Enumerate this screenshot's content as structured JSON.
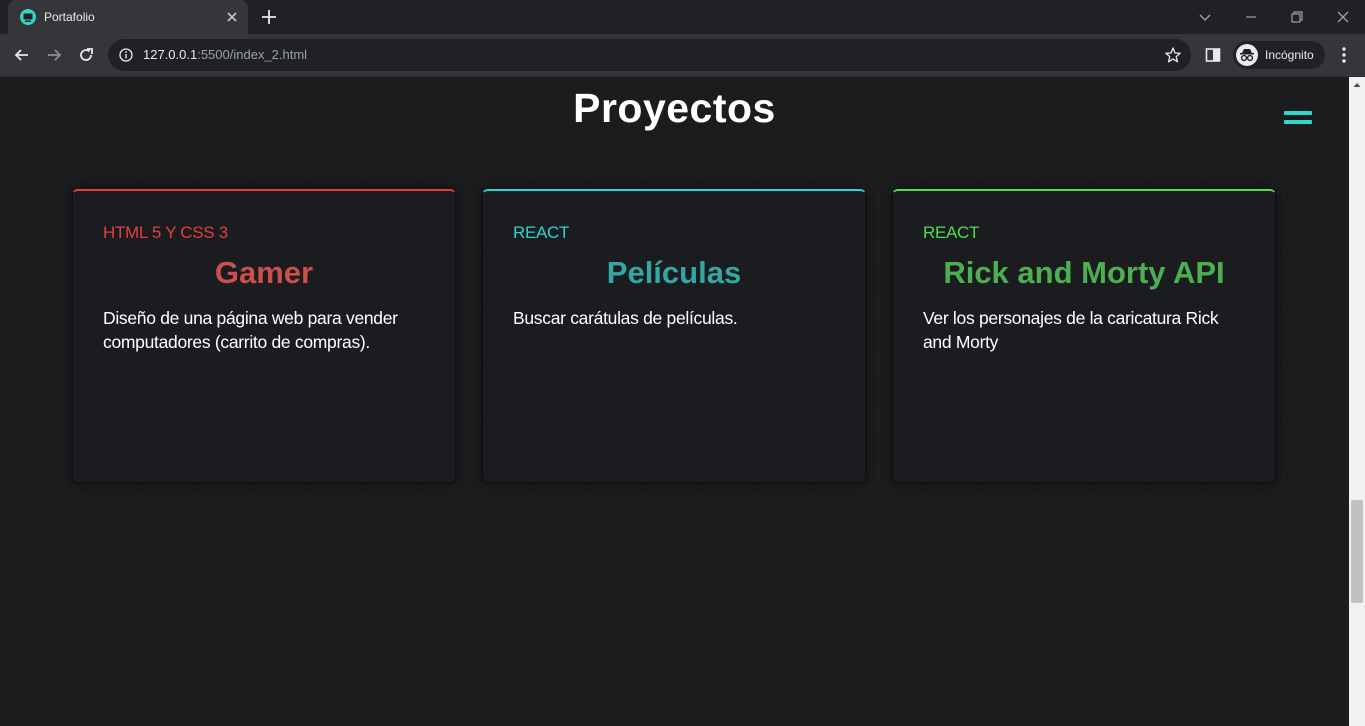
{
  "browser": {
    "tab_title": "Portafolio",
    "url_host": "127.0.0.1",
    "url_path": ":5500/index_2.html",
    "profile_label": "Incógnito"
  },
  "page": {
    "section_title": "Proyectos",
    "accent_color": "#34d6c9"
  },
  "projects": [
    {
      "tag": "HTML 5 Y CSS 3",
      "title": "Gamer",
      "description": "Diseño de una página web para vender computadores (carrito de compras).",
      "tag_color": "#e0413e",
      "title_color": "#c9504c"
    },
    {
      "tag": "REACT",
      "title": "Películas",
      "description": "Buscar carátulas de películas.",
      "tag_color": "#2fd3d0",
      "title_color": "#34a7a4"
    },
    {
      "tag": "REACT",
      "title": "Rick and Morty API",
      "description": "Ver los personajes de la caricatura Rick and Morty",
      "tag_color": "#4fdc50",
      "title_color": "#4caf50"
    }
  ]
}
